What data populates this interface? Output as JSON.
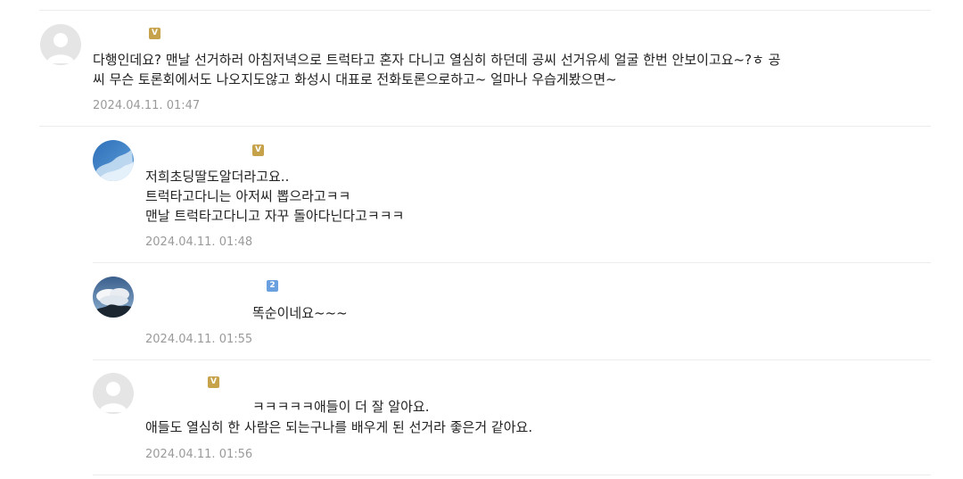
{
  "comments": [
    {
      "badge": "V",
      "lines": [
        "다행인데요? 맨날 선거하러 아침저녁으로 트럭타고 혼자 다니고 열심히 하던데 공씨 선거유세 얼굴 한번 안보이고요~?ㅎ 공",
        "씨 무슨 토론회에서도 나오지도않고 화성시 대표로 전화토론으로하고~ 얼마나 우습게봤으면~"
      ],
      "date": "2024.04.11. 01:47"
    },
    {
      "badge": "V",
      "lines": [
        "저희초딩딸도알더라고요..",
        "트럭타고다니는 아저씨 뽑으라고ㅋㅋ",
        "맨날 트럭타고다니고 자꾸 돌아다닌다고ㅋㅋㅋ"
      ],
      "date": "2024.04.11. 01:48"
    },
    {
      "badge": "2",
      "lines": [
        "똑순이네요~~~"
      ],
      "date": "2024.04.11. 01:55"
    },
    {
      "badge": "V",
      "lines": [
        "ㅋㅋㅋㅋㅋ애들이 더 잘 알아요.",
        "애들도 열심히 한 사람은 되는구나를 배우게 된 선거라 좋은거 같아요."
      ],
      "date": "2024.04.11. 01:56"
    }
  ]
}
